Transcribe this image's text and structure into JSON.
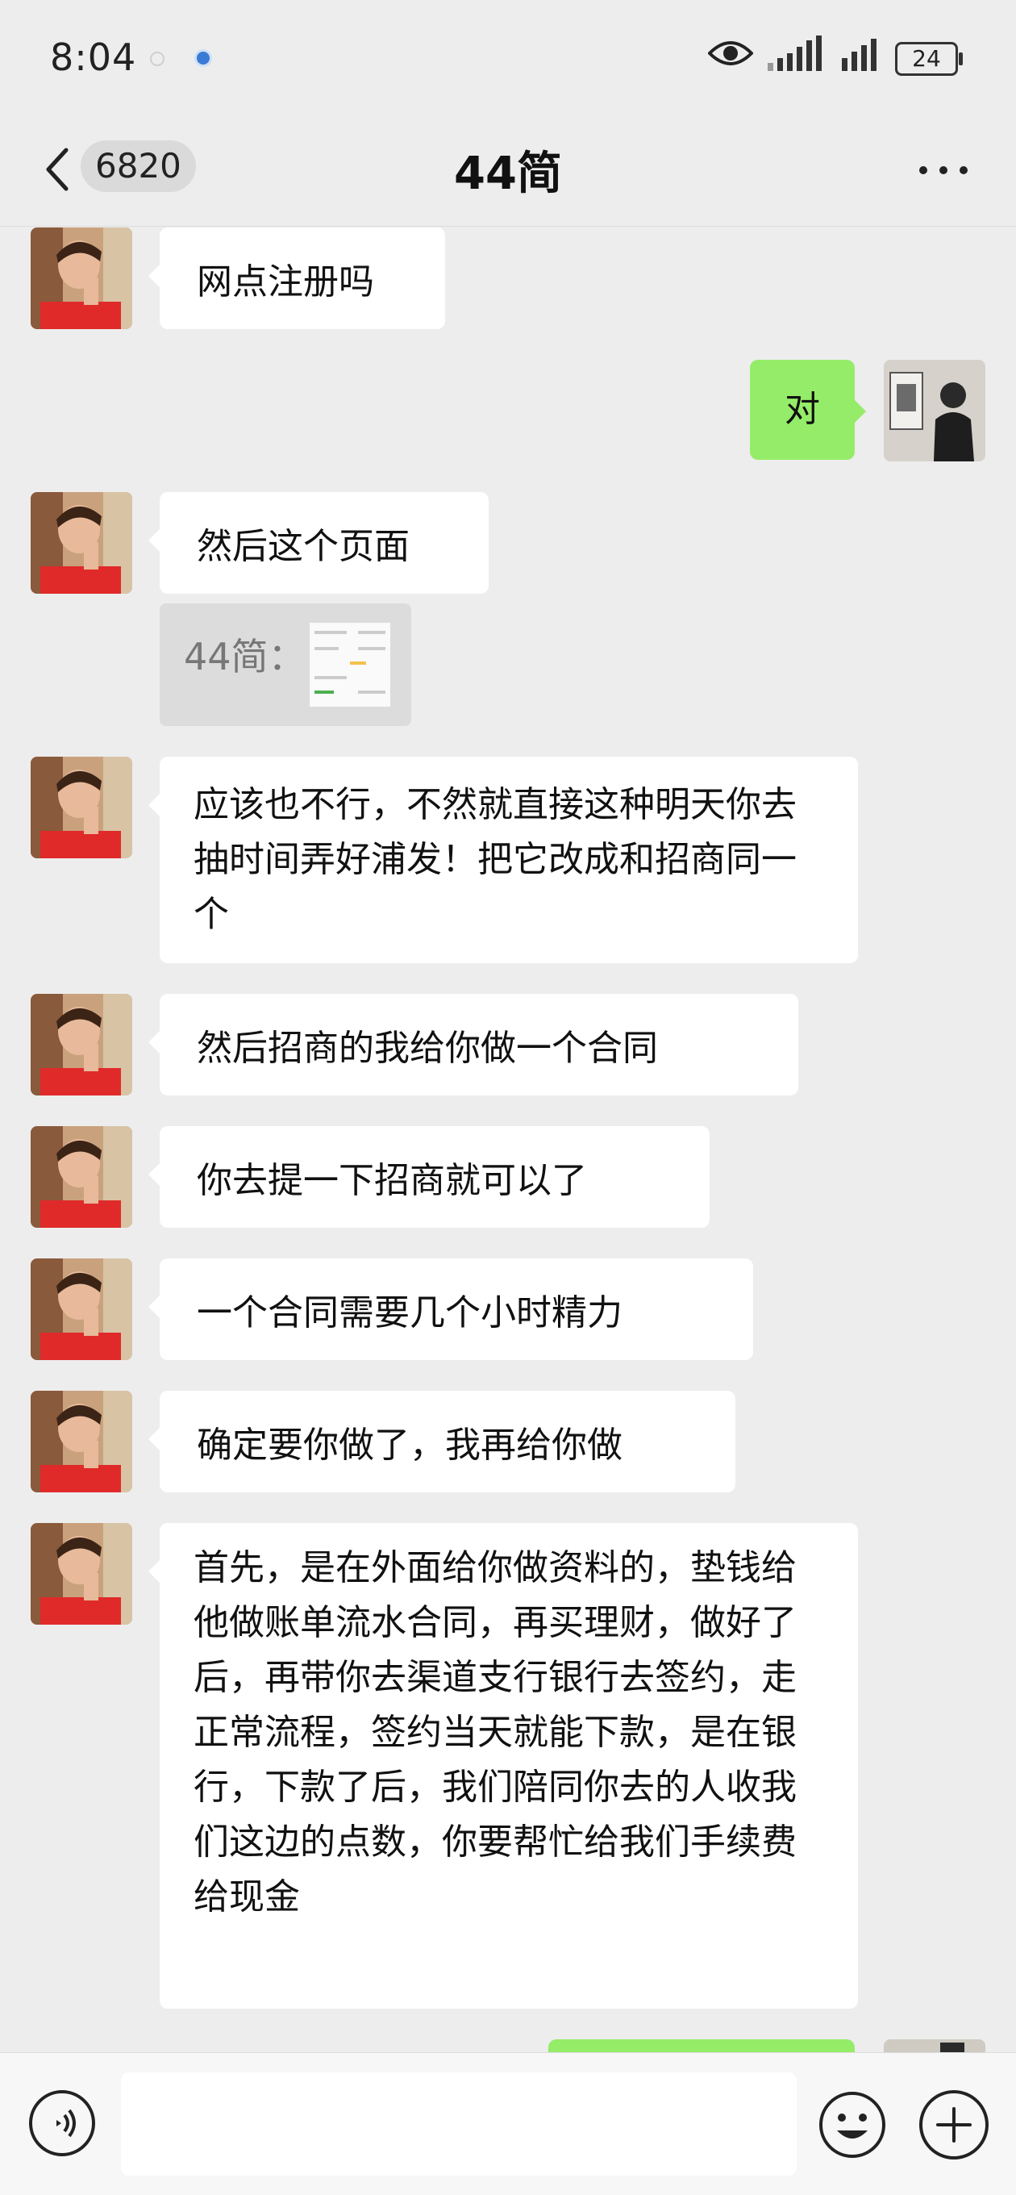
{
  "status_bar": {
    "time": "8:04",
    "battery": "24"
  },
  "nav": {
    "back_badge": "6820",
    "title": "44简"
  },
  "messages": [
    {
      "side": "left",
      "text": "网点注册吗"
    },
    {
      "side": "right",
      "text": "对"
    },
    {
      "side": "left",
      "text": "然后这个页面"
    },
    {
      "side": "quote",
      "text": "44简："
    },
    {
      "side": "left",
      "text": "应该也不行，不然就直接这种明天你去抽时间弄好浦发！把它改成和招商同一个"
    },
    {
      "side": "left",
      "text": "然后招商的我给你做一个合同"
    },
    {
      "side": "left",
      "text": "你去提一下招商就可以了"
    },
    {
      "side": "left",
      "text": "一个合同需要几个小时精力"
    },
    {
      "side": "left",
      "text": "确定要你做了，我再给你做"
    },
    {
      "side": "left",
      "text": "首先，是在外面给你做资料的，垫钱给他做账单流水合同，再买理财，做好了后，再带你去渠道支行银行去签约，走正常流程，签约当天就能下款，是在银行，下款了后，我们陪同你去的人收我们这边的点数，你要帮忙给我们手续费给现金"
    }
  ],
  "colors": {
    "background": "#ededed",
    "my_bubble": "#95ec69",
    "their_bubble": "#ffffff"
  },
  "icons": {
    "back": "chevron-left-icon",
    "more": "more-dots-icon",
    "voice": "voice-icon",
    "emoji": "emoji-icon",
    "plus": "plus-icon",
    "eye": "eye-icon",
    "signal": "signal-icon"
  }
}
